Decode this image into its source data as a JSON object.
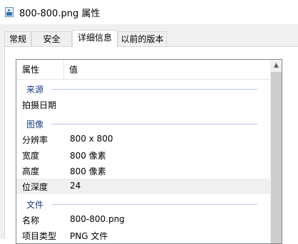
{
  "window": {
    "title": "800-800.png 属性",
    "icon": "png-image-icon"
  },
  "tabs": [
    {
      "label": "常规",
      "active": false
    },
    {
      "label": "安全",
      "active": false
    },
    {
      "label": "详细信息",
      "active": true
    },
    {
      "label": "以前的版本",
      "active": false
    }
  ],
  "details": {
    "header_property": "属性",
    "header_value": "值",
    "groups": {
      "source": "来源",
      "image": "图像",
      "file": "文件"
    },
    "rows": {
      "date_taken": {
        "name": "拍摄日期",
        "value": ""
      },
      "resolution": {
        "name": "分辨率",
        "value": "800 x 800"
      },
      "width": {
        "name": "宽度",
        "value": "800 像素"
      },
      "height": {
        "name": "高度",
        "value": "800 像素"
      },
      "bit_depth": {
        "name": "位深度",
        "value": "24"
      },
      "name": {
        "name": "名称",
        "value": "800-800.png"
      },
      "item_type": {
        "name": "项目类型",
        "value": "PNG 文件"
      }
    },
    "selected_row": "位深度"
  },
  "scrollbar": {
    "up_arrow": "▲"
  }
}
